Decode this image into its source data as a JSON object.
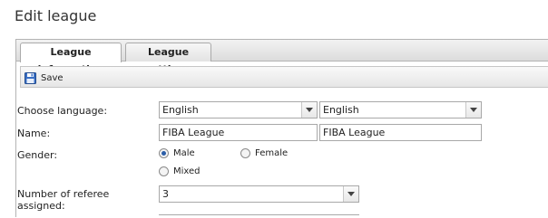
{
  "page": {
    "title": "Edit league"
  },
  "tabs": [
    {
      "label": "League information",
      "active": true
    },
    {
      "label": "League settings",
      "active": false
    }
  ],
  "toolbar": {
    "save_label": "Save"
  },
  "form": {
    "language": {
      "label": "Choose language:",
      "value1": "English",
      "value2": "English"
    },
    "name": {
      "label": "Name:",
      "value1": "FIBA League",
      "value2": "FIBA League"
    },
    "gender": {
      "label": "Gender:",
      "options": [
        {
          "label": "Male",
          "selected": true
        },
        {
          "label": "Female",
          "selected": false
        },
        {
          "label": "Mixed",
          "selected": false
        }
      ]
    },
    "referee": {
      "label_line1": "Number of referee",
      "label_line2": "assigned:",
      "value": "3"
    }
  },
  "colors": {
    "radio_selected": "#2b5ea8",
    "tab_border": "#aaaaaa"
  }
}
